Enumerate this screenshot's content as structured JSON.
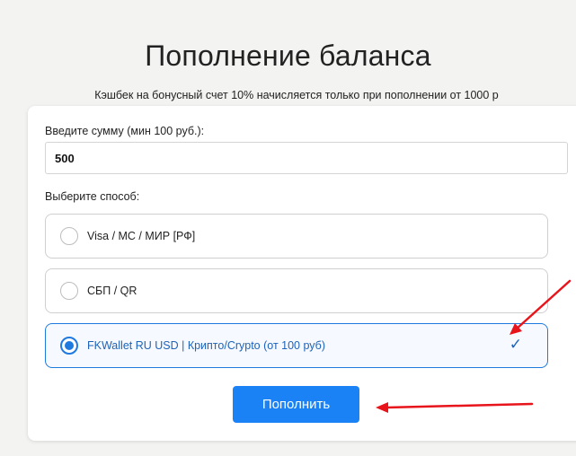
{
  "page": {
    "title": "Пополнение баланса",
    "cashback_note": "Кэшбек на бонусный счет 10% начисляется только при пополнении от 1000 р"
  },
  "form": {
    "amount_label": "Введите сумму (мин 100 руб.):",
    "amount_value": "500",
    "method_label": "Выберите способ:",
    "methods": [
      {
        "label": "Visa / MC / МИР [РФ]",
        "selected": false
      },
      {
        "label": "СБП / QR",
        "selected": false
      },
      {
        "label": "FKWallet RU USD | Крипто/Crypto (от 100 руб)",
        "selected": true
      }
    ],
    "selected_check": "✓",
    "submit_label": "Пополнить"
  },
  "colors": {
    "accent": "#1a82f4",
    "selected_text": "#1f63b8",
    "annotation_arrow": "#e8141b"
  }
}
